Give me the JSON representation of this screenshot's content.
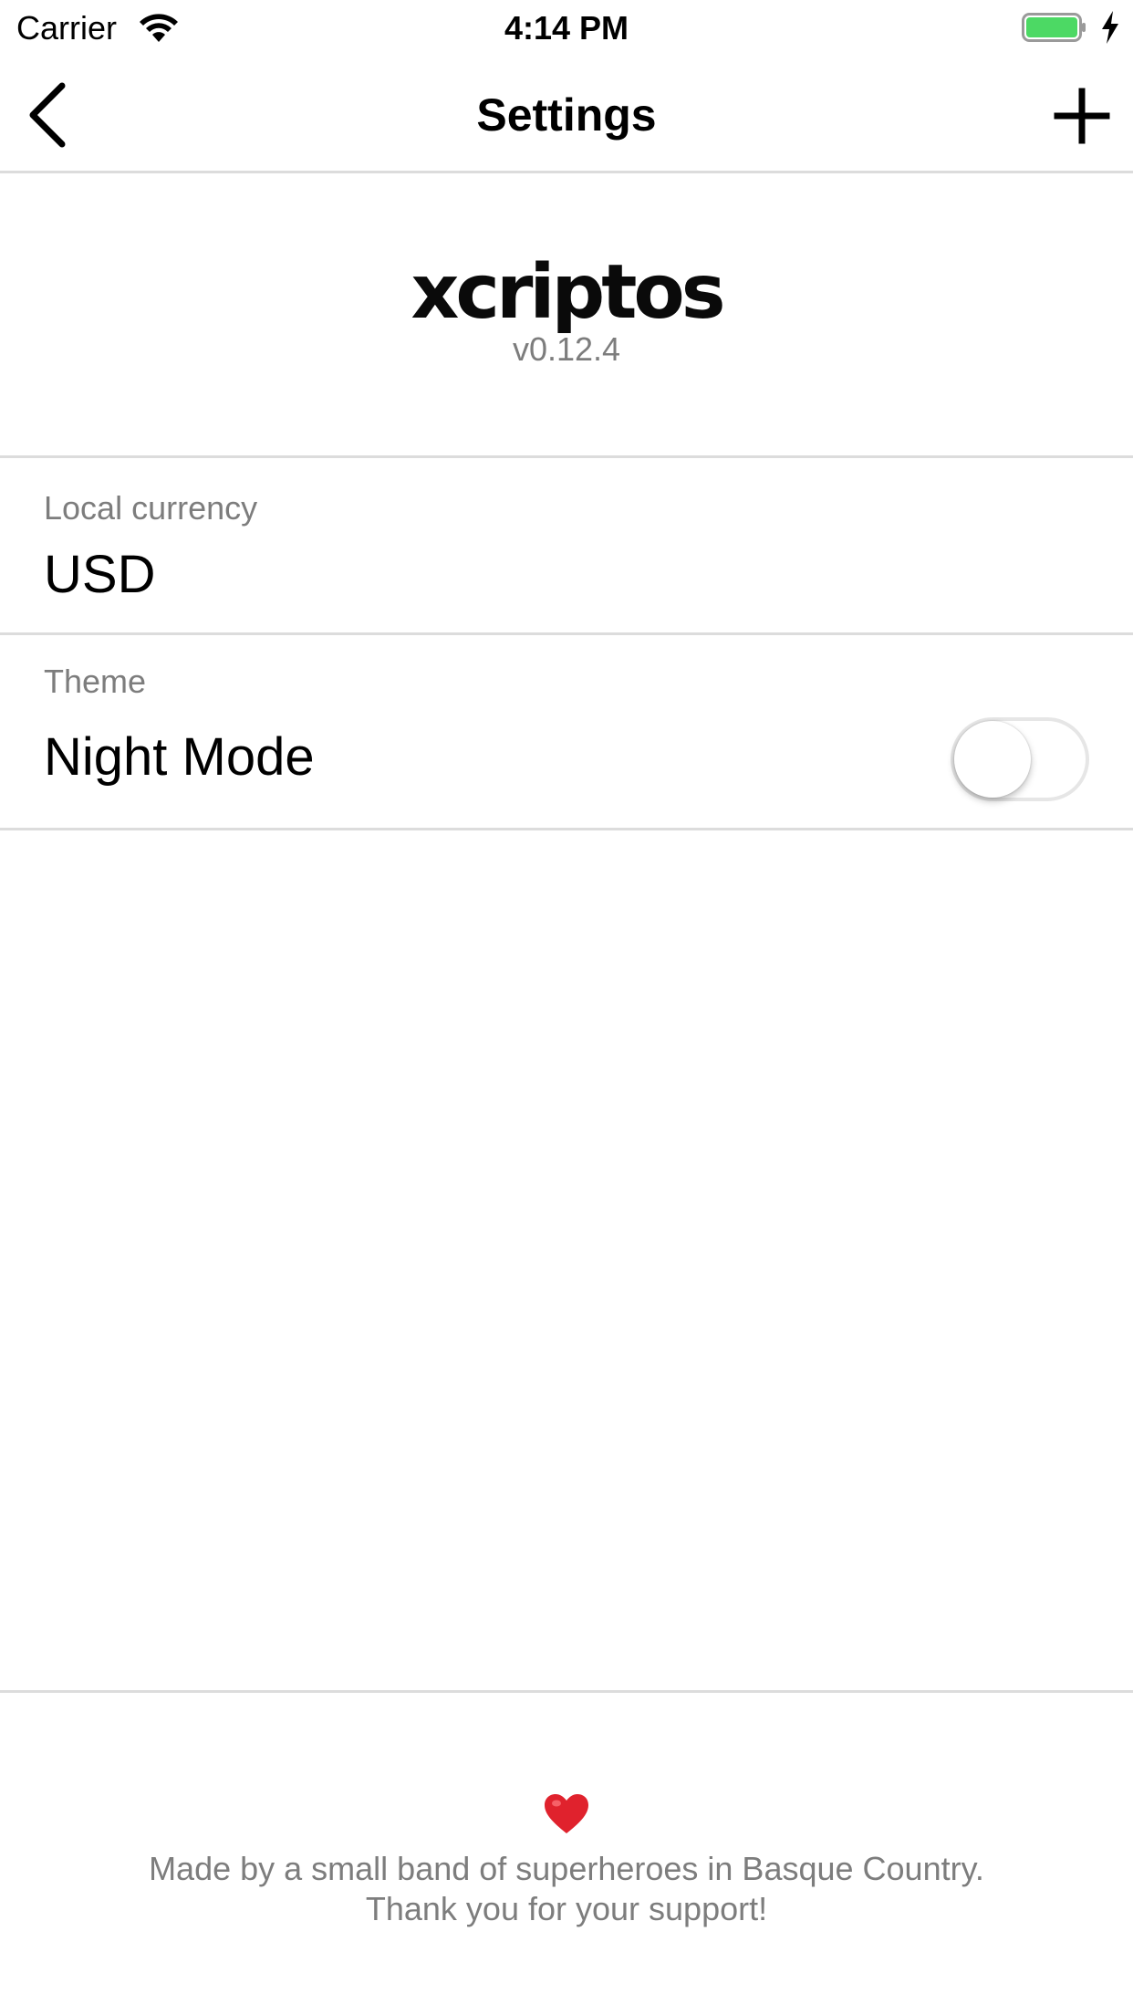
{
  "status_bar": {
    "carrier": "Carrier",
    "time": "4:14 PM",
    "battery_color": "#4cd964"
  },
  "nav": {
    "title": "Settings",
    "back_icon": "chevron-left-icon",
    "add_icon": "plus-icon"
  },
  "app": {
    "logo": "xcriptos",
    "version": "v0.12.4"
  },
  "settings": {
    "currency": {
      "label": "Local currency",
      "value": "USD"
    },
    "theme": {
      "label": "Theme",
      "value": "Night Mode",
      "toggle_on": false
    }
  },
  "footer": {
    "heart_icon": "heart-icon",
    "heart_color": "#e0222d",
    "line1": "Made by a small band of superheroes in Basque Country.",
    "line2": "Thank you for your support!"
  }
}
